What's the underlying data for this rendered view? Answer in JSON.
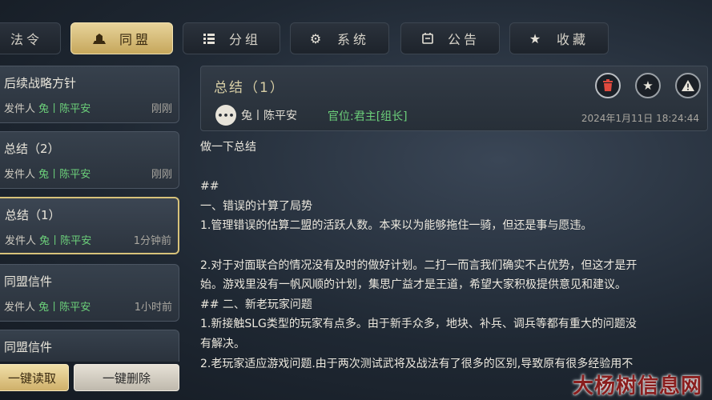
{
  "tabs": [
    {
      "label": "法令",
      "icon": "edict-icon"
    },
    {
      "label": "同盟",
      "icon": "alliance-icon"
    },
    {
      "label": "分组",
      "icon": "group-icon"
    },
    {
      "label": "系统",
      "icon": "gear-icon"
    },
    {
      "label": "公告",
      "icon": "notice-icon"
    },
    {
      "label": "收藏",
      "icon": "star-icon"
    }
  ],
  "mail_list": [
    {
      "title": "后续战略方针",
      "sender_prefix": "发件人",
      "sender_name": "兔",
      "sep": "丨",
      "sender_role": "陈平安",
      "time": "刚刚"
    },
    {
      "title": "总结（2）",
      "sender_prefix": "发件人",
      "sender_name": "兔",
      "sep": "丨",
      "sender_role": "陈平安",
      "time": "刚刚"
    },
    {
      "title": "总结（1）",
      "sender_prefix": "发件人",
      "sender_name": "兔",
      "sep": "丨",
      "sender_role": "陈平安",
      "time": "1分钟前"
    },
    {
      "title": "同盟信件",
      "sender_prefix": "发件人",
      "sender_name": "兔",
      "sep": "丨",
      "sender_role": "陈平安",
      "time": "1小时前"
    },
    {
      "title": "同盟信件",
      "sender_prefix": "",
      "sender_name": "",
      "sep": "",
      "sender_role": "",
      "time": ""
    }
  ],
  "buttons": {
    "read_all": "一键读取",
    "delete_all": "一键删除"
  },
  "detail": {
    "title": "总结（1）",
    "sender": "兔丨陈平安",
    "rank": "官位:君主[组长]",
    "time": "2024年1月11日 18:24:44",
    "lines": [
      "做一下总结",
      "",
      "##",
      "一、错误的计算了局势",
      "1.管理错误的估算二盟的活跃人数。本来以为能够拖住一骑，但还是事与愿违。",
      "",
      "2.对于对面联合的情况没有及时的做好计划。二打一而言我们确实不占优势，但这才是开",
      "始。游戏里没有一帆风顺的计划，集思广益才是王道，希望大家积极提供意见和建议。",
      "## 二、新老玩家问题",
      "1.新接触SLG类型的玩家有点多。由于新手众多，地块、补兵、调兵等都有重大的问题没",
      "有解决。",
      "2.老玩家适应游戏问题.由于两次测试武将及战法有了很多的区别,导致原有很多经验用不"
    ]
  },
  "watermark": "大杨树信息网"
}
